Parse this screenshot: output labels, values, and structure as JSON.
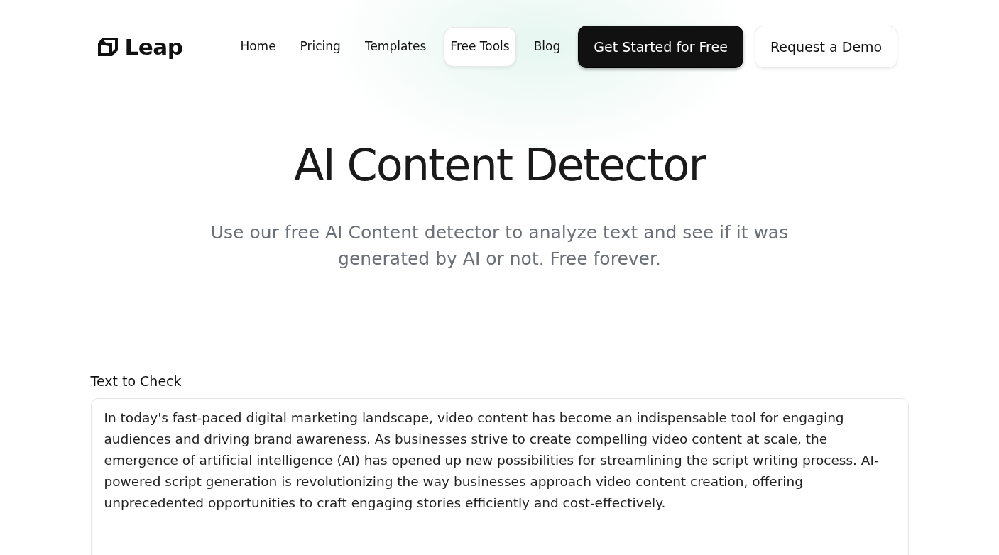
{
  "logo": {
    "text": "Leap"
  },
  "nav": [
    {
      "label": "Home",
      "selected": false
    },
    {
      "label": "Pricing",
      "selected": false
    },
    {
      "label": "Templates",
      "selected": false
    },
    {
      "label": "Free Tools",
      "selected": true
    },
    {
      "label": "Blog",
      "selected": false
    }
  ],
  "buttons": [
    {
      "label": "Get Started for Free",
      "kind": "primary"
    },
    {
      "label": "Request a Demo",
      "kind": "secondary"
    }
  ],
  "hero": {
    "title": "AI Content Detector",
    "subtitle": "Use our free AI Content detector to analyze text and see if it was generated by AI or not. Free forever."
  },
  "form": {
    "label": "Text to Check",
    "value": "In today's fast-paced digital marketing landscape, video content has become an indispensable tool for engaging audiences and driving brand awareness. As businesses strive to create compelling video content at scale, the emergence of artificial intelligence (AI) has opened up new possibilities for streamlining the script writing process. AI-powered script generation is revolutionizing the way businesses approach video content creation, offering unprecedented opportunities to craft engaging stories efficiently and cost-effectively."
  }
}
